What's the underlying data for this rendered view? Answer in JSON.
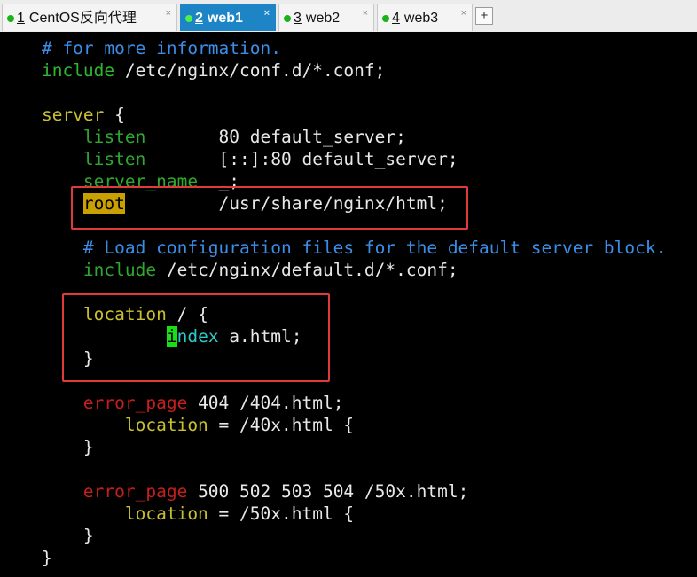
{
  "tabs": [
    {
      "num": "1",
      "label": "CentOS反向代理",
      "active": false,
      "close": "×"
    },
    {
      "num": "2",
      "label": "web1",
      "active": true,
      "close": "×"
    },
    {
      "num": "3",
      "label": "web2",
      "active": false,
      "close": "×"
    },
    {
      "num": "4",
      "label": "web3",
      "active": false,
      "close": "×"
    }
  ],
  "add_tab_label": "+",
  "terminal": {
    "l1": "    # for more information.",
    "l2_kw": "    include",
    "l2_rest": " /etc/nginx/conf.d/*.conf;",
    "l4_kw": "    server",
    "l4_rest": " {",
    "l5_kw": "        listen",
    "l5_rest": "       80 default_server;",
    "l6_kw": "        listen",
    "l6_rest": "       [::]:80 default_server;",
    "l7_kw": "        server_name",
    "l7_rest": "  _;",
    "l8_pre": "        ",
    "l8_kw": "root",
    "l8_rest": "         /usr/share/nginx/html;",
    "l10": "        # Load configuration files for the default server block.",
    "l11_kw": "        include",
    "l11_rest": " /etc/nginx/default.d/*.conf;",
    "l13_kw": "        location",
    "l13_rest": " / {",
    "l14_pre": "                ",
    "l14_cursor": "i",
    "l14_kw": "ndex",
    "l14_rest": " a.html;",
    "l15": "        }",
    "l17_kw": "        error_page",
    "l17_rest": " 404 /404.html;",
    "l18_kw": "            location",
    "l18_rest": " = /40x.html {",
    "l19": "        }",
    "l21_kw": "        error_page",
    "l21_rest": " 500 502 503 504 /50x.html;",
    "l22_kw": "            location",
    "l22_rest": " = /50x.html {",
    "l23": "        }",
    "l24": "    }"
  },
  "colors": {
    "highlight_box": "#e03a3a",
    "active_tab": "#1d84c6",
    "comment": "#3a8ee8",
    "directive_green": "#2fa82f",
    "directive_red": "#c81e1e",
    "directive_yellow": "#c8c030"
  }
}
